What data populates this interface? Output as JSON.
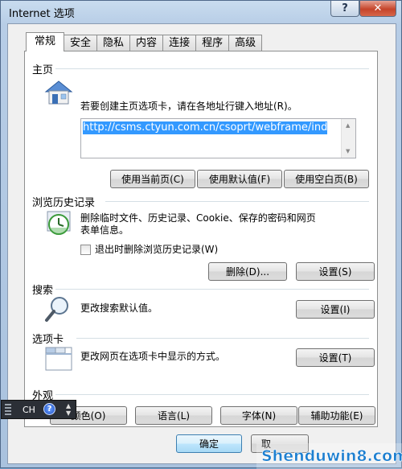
{
  "window": {
    "title": "Internet 选项",
    "help_label": "?",
    "close_label": "✕"
  },
  "tabs": [
    {
      "label": "常规"
    },
    {
      "label": "安全"
    },
    {
      "label": "隐私"
    },
    {
      "label": "内容"
    },
    {
      "label": "连接"
    },
    {
      "label": "程序"
    },
    {
      "label": "高级"
    }
  ],
  "home": {
    "title": "主页",
    "icon": "house-icon",
    "description": "若要创建主页选项卡，请在各地址行键入地址(R)。",
    "url": "http://csms.ctyun.com.cn/csoprt/webframe/ind",
    "buttons": [
      "使用当前页(C)",
      "使用默认值(F)",
      "使用空白页(B)"
    ]
  },
  "history": {
    "title": "浏览历史记录",
    "icon": "history-clock-icon",
    "description_line1": "删除临时文件、历史记录、Cookie、保存的密码和网页",
    "description_line2": "表单信息。",
    "checkbox_label": "退出时删除浏览历史记录(W)",
    "delete_label": "删除(D)...",
    "settings_label": "设置(S)"
  },
  "search": {
    "title": "搜索",
    "icon": "magnifier-icon",
    "description": "更改搜索默认值。",
    "settings_label": "设置(I)"
  },
  "tabsgroup": {
    "title": "选项卡",
    "icon": "tabs-window-icon",
    "description": "更改网页在选项卡中显示的方式。",
    "settings_label": "设置(T)"
  },
  "appearance": {
    "title": "外观",
    "buttons": [
      "颜色(O)",
      "语言(L)",
      "字体(N)",
      "辅助功能(E)"
    ]
  },
  "dialog": {
    "ok_label": "确定",
    "cancel_label": "取"
  },
  "langbar": {
    "lang": "CH",
    "help_label": "?"
  },
  "watermark": {
    "text": "Shenduwin8.com"
  }
}
